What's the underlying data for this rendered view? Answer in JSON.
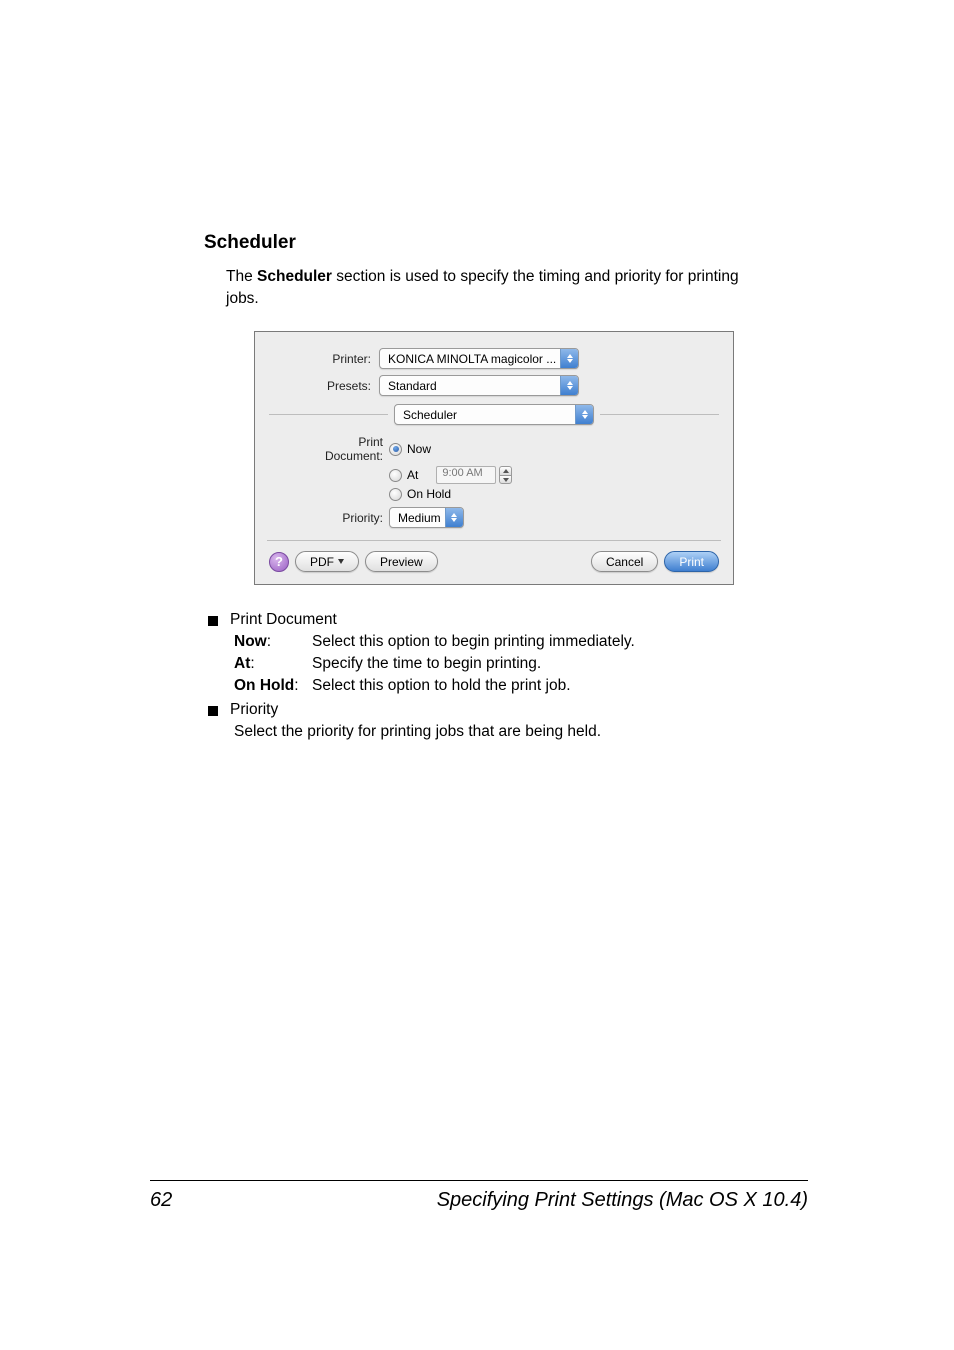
{
  "heading": "Scheduler",
  "intro_pre": "The ",
  "intro_bold": "Scheduler",
  "intro_post": " section is used to specify the timing and priority for printing jobs.",
  "panel": {
    "printer_label": "Printer:",
    "printer_value": "KONICA MINOLTA magicolor ...",
    "presets_label": "Presets:",
    "presets_value": "Standard",
    "section_value": "Scheduler",
    "print_doc_label": "Print Document:",
    "opt_now": "Now",
    "opt_at": "At",
    "opt_hold": "On Hold",
    "time_value": "9:00 AM",
    "priority_label": "Priority:",
    "priority_value": "Medium",
    "help": "?",
    "pdf": "PDF",
    "preview": "Preview",
    "cancel": "Cancel",
    "print": "Print"
  },
  "bullets": {
    "print_document": "Print Document",
    "now_term": "Now",
    "now_desc": "Select this option to begin printing immediately.",
    "at_term": "At",
    "at_desc": "Specify the time to begin printing.",
    "hold_term": "On Hold",
    "hold_desc": "Select this option to hold the print job.",
    "priority": "Priority",
    "priority_desc": "Select the priority for printing jobs that are being held."
  },
  "footer": {
    "page": "62",
    "title": "Specifying Print Settings (Mac OS X 10.4)"
  }
}
